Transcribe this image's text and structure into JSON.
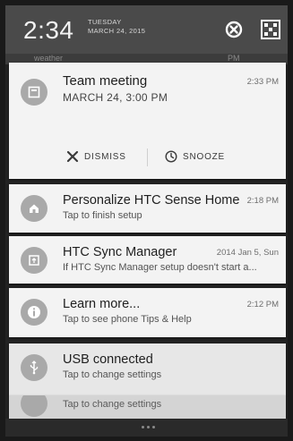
{
  "status_header": {
    "time": "2:34",
    "day": "TUESDAY",
    "date": "MARCH 24, 2015"
  },
  "behind_text": {
    "left": "weather",
    "right": "PM"
  },
  "notifications": [
    {
      "title": "Team meeting",
      "subtitle": "MARCH 24, 3:00 PM",
      "time": "2:33 PM",
      "icon": "calendar-icon",
      "actions": [
        {
          "label": "DISMISS",
          "icon": "x-icon"
        },
        {
          "label": "SNOOZE",
          "icon": "clock-icon"
        }
      ]
    },
    {
      "title": "Personalize HTC Sense Home",
      "subtitle": "Tap to finish setup",
      "time": "2:18 PM",
      "icon": "home-icon"
    },
    {
      "title": "HTC Sync Manager",
      "subtitle": "If HTC Sync Manager setup doesn't start a...",
      "time": "2014 Jan 5, Sun",
      "icon": "sync-icon"
    },
    {
      "title": "Learn more...",
      "subtitle": "Tap to see phone Tips & Help",
      "time": "2:12 PM",
      "icon": "info-icon"
    },
    {
      "title": "USB connected",
      "subtitle": "Tap to change settings",
      "icon": "usb-icon"
    },
    {
      "subtitle": "Tap to change settings",
      "icon": "usb-icon"
    }
  ],
  "colors": {
    "header_bg": "#4a4a4a",
    "card_bg": "#f3f3f3",
    "avatar_bg": "#a9a9a9"
  }
}
